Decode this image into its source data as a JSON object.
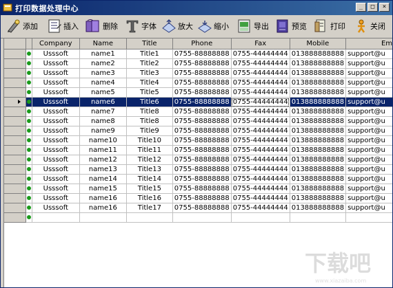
{
  "window": {
    "title": "打印数据处理中心",
    "buttons": {
      "minimize": "_",
      "maximize": "□",
      "close": "×"
    }
  },
  "toolbar": {
    "items": [
      {
        "label": "添加",
        "icon": "add-icon"
      },
      {
        "label": "插入",
        "icon": "insert-icon"
      },
      {
        "label": "删除",
        "icon": "delete-icon"
      },
      {
        "label": "字体",
        "icon": "font-icon"
      },
      {
        "label": "放大",
        "icon": "zoom-in-icon"
      },
      {
        "label": "缩小",
        "icon": "zoom-out-icon"
      },
      {
        "label": "导出",
        "icon": "export-icon"
      },
      {
        "label": "预览",
        "icon": "preview-icon"
      },
      {
        "label": "打印",
        "icon": "print-icon"
      },
      {
        "label": "关闭",
        "icon": "close-icon"
      }
    ]
  },
  "grid": {
    "columns": [
      "Company",
      "Name",
      "Title",
      "Phone",
      "Fax",
      "Mobile",
      "Em"
    ],
    "selected_row": 5,
    "rows": [
      [
        "Usssoft",
        "name1",
        "Title1",
        "0755-88888888",
        "0755-44444444",
        "013888888888",
        "support@u"
      ],
      [
        "Usssoft",
        "name2",
        "Title2",
        "0755-88888888",
        "0755-44444444",
        "013888888888",
        "support@u"
      ],
      [
        "Usssoft",
        "name3",
        "Title3",
        "0755-88888888",
        "0755-44444444",
        "013888888888",
        "support@u"
      ],
      [
        "Usssoft",
        "name4",
        "Title4",
        "0755-88888888",
        "0755-44444444",
        "013888888888",
        "support@u"
      ],
      [
        "Usssoft",
        "name5",
        "Title5",
        "0755-88888888",
        "0755-44444444",
        "013888888888",
        "support@u"
      ],
      [
        "Usssoft",
        "name6",
        "Title6",
        "0755-88888888",
        "0755-44444444",
        "013888888888",
        "support@u"
      ],
      [
        "Usssoft",
        "name7",
        "Title8",
        "0755-88888888",
        "0755-44444444",
        "013888888888",
        "support@u"
      ],
      [
        "Usssoft",
        "name8",
        "Title8",
        "0755-88888888",
        "0755-44444444",
        "013888888888",
        "support@u"
      ],
      [
        "Usssoft",
        "name9",
        "Title9",
        "0755-88888888",
        "0755-44444444",
        "013888888888",
        "support@u"
      ],
      [
        "Usssoft",
        "name10",
        "Title10",
        "0755-88888888",
        "0755-44444444",
        "013888888888",
        "support@u"
      ],
      [
        "Usssoft",
        "name11",
        "Title11",
        "0755-88888888",
        "0755-44444444",
        "013888888888",
        "support@u"
      ],
      [
        "Usssoft",
        "name12",
        "Title12",
        "0755-88888888",
        "0755-44444444",
        "013888888888",
        "support@u"
      ],
      [
        "Usssoft",
        "name13",
        "Title13",
        "0755-88888888",
        "0755-44444444",
        "013888888888",
        "support@u"
      ],
      [
        "Usssoft",
        "name14",
        "Title14",
        "0755-88888888",
        "0755-44444444",
        "013888888888",
        "support@u"
      ],
      [
        "Usssoft",
        "name15",
        "Title15",
        "0755-88888888",
        "0755-44444444",
        "013888888888",
        "support@u"
      ],
      [
        "Usssoft",
        "name16",
        "Title16",
        "0755-88888888",
        "0755-44444444",
        "013888888888",
        "support@u"
      ],
      [
        "Usssoft",
        "name16",
        "Title17",
        "0755-88888888",
        "0755-44444444",
        "013888888888",
        "support@u"
      ]
    ]
  },
  "watermark": {
    "text": "下载吧",
    "sub": "www.xiazaiba.com"
  },
  "colors": {
    "titlebar": "#0a246a",
    "selection": "#0a246a",
    "status_dot": "#1a9a1a"
  }
}
